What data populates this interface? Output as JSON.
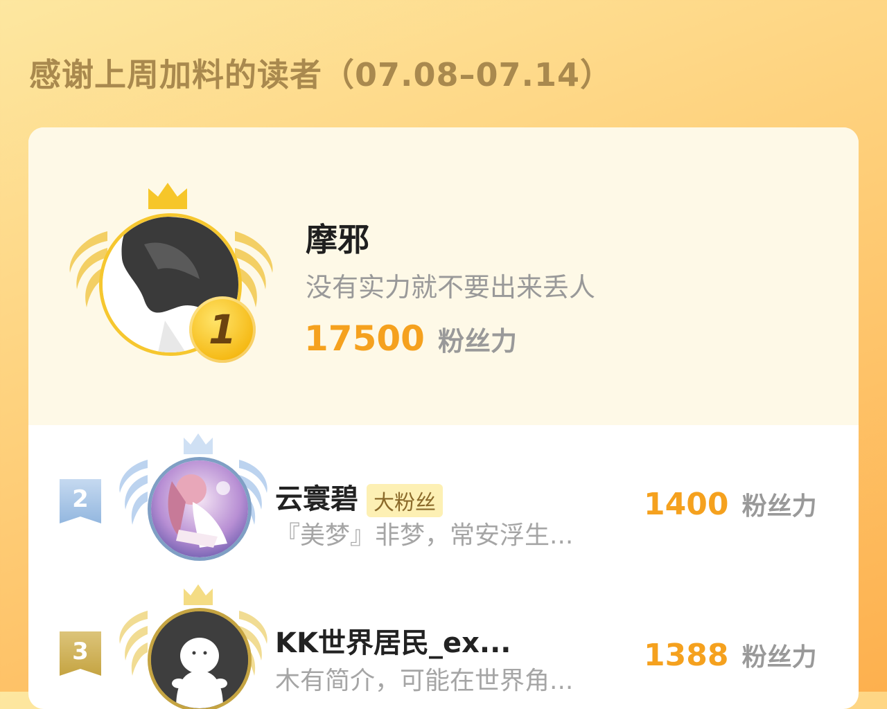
{
  "header": {
    "title": "感谢上周加料的读者（07.08–07.14）"
  },
  "colors": {
    "accent": "#f5a11e",
    "gold": "#f6c72f",
    "silver": "#a8c4e4",
    "bronze": "#c9a94a"
  },
  "top_reader": {
    "rank": "1",
    "name": "摩邪",
    "bio": "没有实力就不要出来丢人",
    "score": "17500",
    "score_unit": "粉丝力"
  },
  "readers": [
    {
      "rank": "2",
      "name": "云寰碧",
      "badge": "大粉丝",
      "bio": "『美梦』非梦，常安浮生...",
      "score": "1400",
      "score_unit": "粉丝力"
    },
    {
      "rank": "3",
      "name": "KK世界居民_ex...",
      "bio": "木有简介，可能在世界角...",
      "score": "1388",
      "score_unit": "粉丝力"
    }
  ]
}
